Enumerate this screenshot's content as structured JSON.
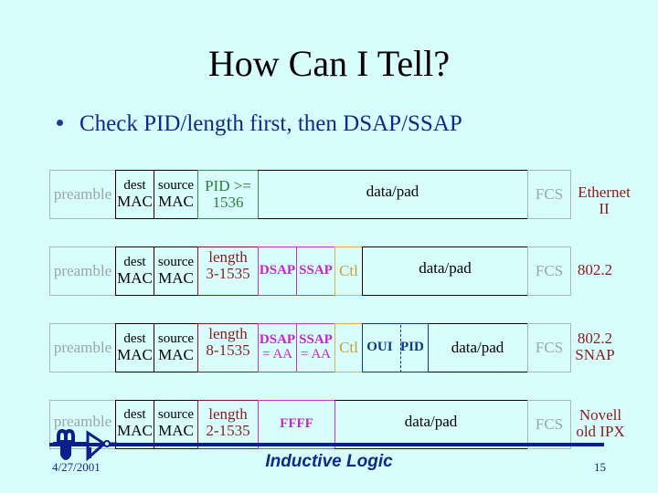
{
  "slide": {
    "title": "How Can I Tell?",
    "bullet": "Check PID/length first, then DSAP/SSAP"
  },
  "frames": [
    {
      "name": "Ethernet II",
      "fields": {
        "preamble": "preamble",
        "dest_top": "dest",
        "dest_bottom": "MAC",
        "src_top": "source",
        "src_bottom": "MAC",
        "type_top": "PID >=",
        "type_bottom": "1536",
        "data": "data/pad",
        "fcs": "FCS"
      },
      "label_line1": "Ethernet",
      "label_line2": "II"
    },
    {
      "name": "802.2",
      "fields": {
        "preamble": "preamble",
        "dest_top": "dest",
        "dest_bottom": "MAC",
        "src_top": "source",
        "src_bottom": "MAC",
        "len_top": "length",
        "len_bottom": "3-1535",
        "dsap": "DSAP",
        "ssap": "SSAP",
        "ctl": "Ctl",
        "data": "data/pad",
        "fcs": "FCS"
      },
      "label_line1": "802.2"
    },
    {
      "name": "802.2 SNAP",
      "fields": {
        "preamble": "preamble",
        "dest_top": "dest",
        "dest_bottom": "MAC",
        "src_top": "source",
        "src_bottom": "MAC",
        "len_top": "length",
        "len_bottom": "8-1535",
        "dsap_top": "DSAP",
        "dsap_bottom": "= AA",
        "ssap_top": "SSAP",
        "ssap_bottom": "= AA",
        "ctl": "Ctl",
        "oui": "OUI",
        "pid": "PID",
        "data": "data/pad",
        "fcs": "FCS"
      },
      "label_line1": "802.2",
      "label_line2": "SNAP"
    },
    {
      "name": "Novell old IPX",
      "fields": {
        "preamble": "preamble",
        "dest_top": "dest",
        "dest_bottom": "MAC",
        "src_top": "source",
        "src_bottom": "MAC",
        "len_top": "length",
        "len_bottom": "2-1535",
        "ffff": "FFFF",
        "data": "data/pad",
        "fcs": "FCS"
      },
      "label_line1": "Novell",
      "label_line2": "old IPX"
    }
  ],
  "footer": {
    "date": "4/27/2001",
    "brand": "Inductive Logic",
    "page": "15",
    "logo_icon": "inductor-inverter-logo-icon"
  },
  "colors": {
    "background": "#d8fdfd",
    "bullet_text": "#0b2a8c",
    "frame_label": "#8b1a1a",
    "pid_green": "#2e7d3a",
    "length_red": "#8b1a1a",
    "sap_magenta": "#cc22cc",
    "ctl_orange": "#c8a030",
    "snap_blue": "#0a3a80",
    "muted_gray": "#9aa6aa"
  }
}
